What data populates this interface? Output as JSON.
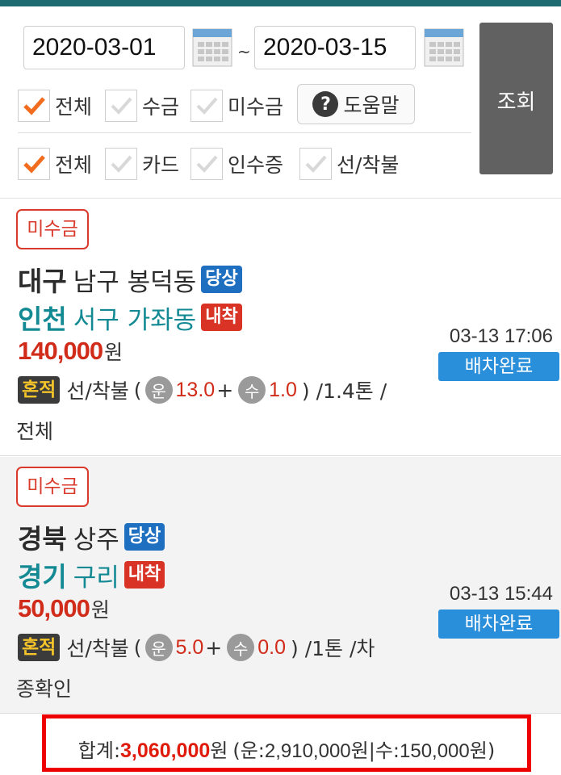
{
  "filter": {
    "start_date": "2020-03-01",
    "end_date": "2020-03-15",
    "separator": "~",
    "query_label": "조회",
    "payment_options": [
      {
        "label": "전체",
        "checked": true
      },
      {
        "label": "수금",
        "checked": false
      },
      {
        "label": "미수금",
        "checked": false
      }
    ],
    "help_label": "도움말",
    "type_options": [
      {
        "label": "전체",
        "checked": true
      },
      {
        "label": "카드",
        "checked": false
      },
      {
        "label": "인수증",
        "checked": false
      },
      {
        "label": "선/착불",
        "checked": false
      }
    ]
  },
  "orders": [
    {
      "badge": "미수금",
      "origin_region": "대구",
      "origin_detail": "남구 봉덕동",
      "origin_tag": "당상",
      "dest_region": "인천",
      "dest_detail": "서구 가좌동",
      "dest_tag": "내착",
      "price": "140,000",
      "currency": "원",
      "load_tag": "혼적",
      "pay_type": "선/착불",
      "fare_icon": "운",
      "fare": "13.0",
      "fee_icon": "수",
      "fee": "1.0",
      "tail": ") /1.4톤 /",
      "vehicle": "전체",
      "time": "03-13 17:06",
      "status": "배차완료"
    },
    {
      "badge": "미수금",
      "origin_region": "경북",
      "origin_detail": "상주",
      "origin_tag": "당상",
      "dest_region": "경기",
      "dest_detail": "구리",
      "dest_tag": "내착",
      "price": "50,000",
      "currency": "원",
      "load_tag": "혼적",
      "pay_type": "선/착불",
      "fare_icon": "운",
      "fare": "5.0",
      "fee_icon": "수",
      "fee": "0.0",
      "tail": ") /1톤 /차",
      "vehicle": "종확인",
      "time": "03-13 15:44",
      "status": "배차완료"
    }
  ],
  "total": {
    "label": "합계:",
    "amount": "3,060,000",
    "currency": "원",
    "breakdown_prefix": "(운:",
    "fare_total": "2,910,000",
    "sep": "원|수:",
    "fee_total": "150,000",
    "suffix": "원)"
  },
  "colors": {
    "accent": "#1f6b72",
    "unpaid": "#d93a2b",
    "status_blue": "#2a8fdb",
    "dest_teal": "#138a93"
  }
}
